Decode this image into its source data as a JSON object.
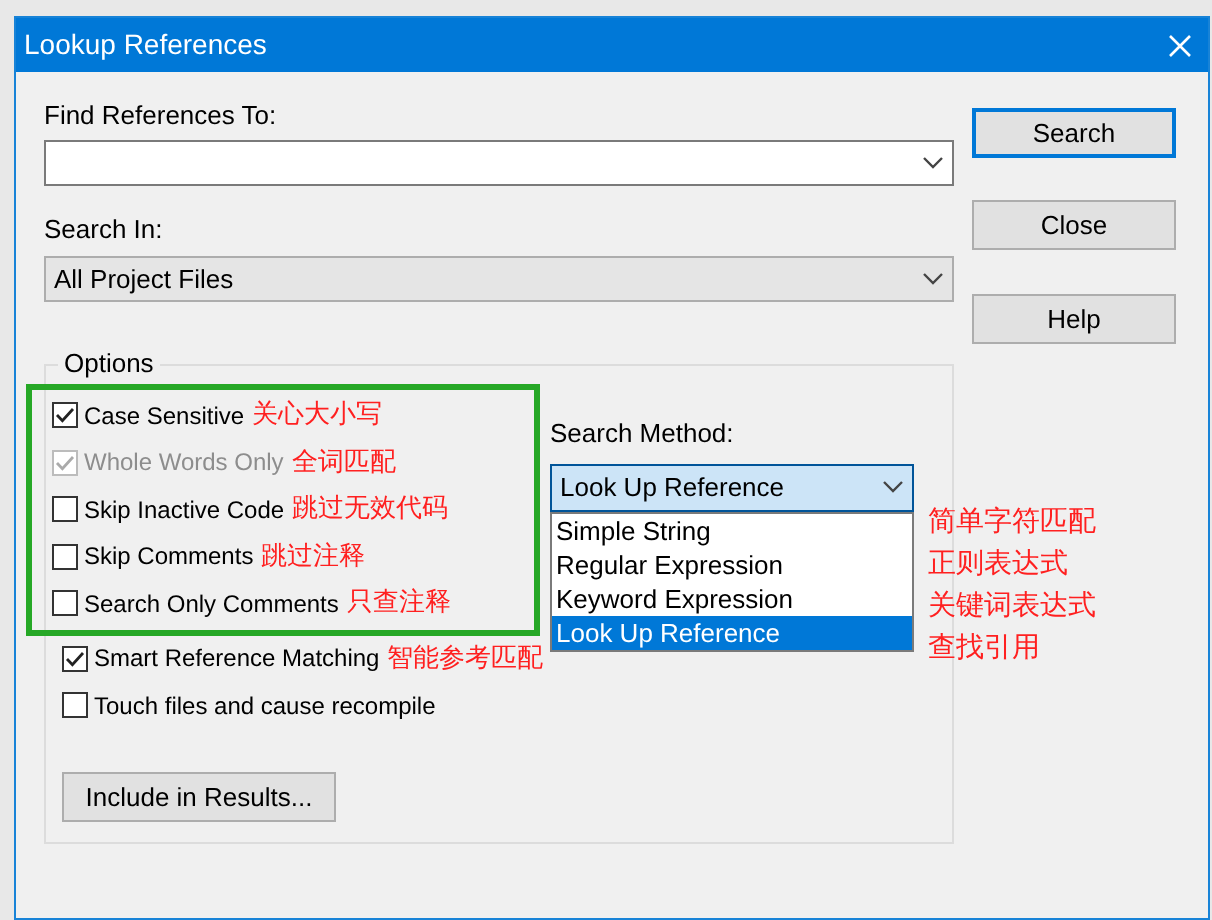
{
  "window": {
    "title": "Lookup References"
  },
  "find_references": {
    "label": "Find References To:"
  },
  "search_in": {
    "label": "Search In:",
    "value": "All Project Files"
  },
  "buttons": [
    {
      "label": "Search",
      "default": true
    },
    {
      "label": "Close",
      "default": false
    },
    {
      "label": "Help",
      "default": false
    }
  ],
  "options": {
    "title": "Options",
    "items": [
      {
        "label": "Case Sensitive",
        "checked": true,
        "disabled": false,
        "highlighted": true,
        "note": "关心大小写"
      },
      {
        "label": "Whole Words Only",
        "checked": true,
        "disabled": true,
        "highlighted": true,
        "note": "全词匹配"
      },
      {
        "label": "Skip Inactive Code",
        "checked": false,
        "disabled": false,
        "highlighted": true,
        "note": "跳过无效代码"
      },
      {
        "label": "Skip Comments",
        "checked": false,
        "disabled": false,
        "highlighted": true,
        "note": "跳过注释"
      },
      {
        "label": "Search Only Comments",
        "checked": false,
        "disabled": false,
        "highlighted": true,
        "note": "只查注释"
      },
      {
        "label": "Smart Reference Matching",
        "checked": true,
        "disabled": false,
        "highlighted": false,
        "note": "智能参考匹配"
      },
      {
        "label": "Touch files and cause recompile",
        "checked": false,
        "disabled": false,
        "highlighted": false
      }
    ],
    "include_button": {
      "label": "Include in Results..."
    }
  },
  "search_method": {
    "label": "Search Method:",
    "value": "Look Up Reference",
    "expanded": true,
    "options": [
      {
        "label": "Simple String",
        "selected": false,
        "note": "简单字符匹配"
      },
      {
        "label": "Regular Expression",
        "selected": false,
        "note": "正则表达式"
      },
      {
        "label": "Keyword Expression",
        "selected": false,
        "note": "关键词表达式"
      },
      {
        "label": "Look Up Reference",
        "selected": true,
        "note": "查找引用"
      }
    ]
  }
}
